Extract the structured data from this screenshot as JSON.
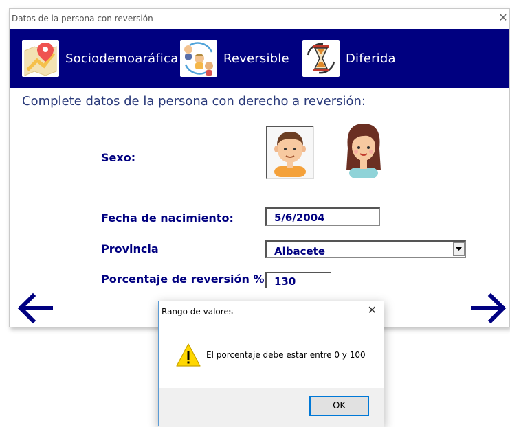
{
  "window": {
    "title": "Datos de la persona con reversión",
    "close_glyph": "✕"
  },
  "tabs": [
    {
      "label": "Sociodemoaráfica",
      "icon": "map-pin-icon"
    },
    {
      "label": "Reversible",
      "icon": "people-exchange-icon"
    },
    {
      "label": "Diferida",
      "icon": "hourglass-icon"
    }
  ],
  "form": {
    "instructions": "Complete datos de la persona con derecho a reversión:",
    "sexo_label": "Sexo:",
    "sexo_options": [
      "male-avatar-icon",
      "female-avatar-icon"
    ],
    "sexo_selected": "male",
    "fecha_label": "Fecha de nacimiento:",
    "fecha_value": "5/6/2004",
    "provincia_label": "Provincia",
    "provincia_value": "Albacete",
    "porcentaje_label": "Porcentaje de reversión %",
    "porcentaje_value": "130"
  },
  "nav": {
    "back_icon": "arrow-left-icon",
    "next_icon": "arrow-right-icon"
  },
  "dialog": {
    "title": "Rango de valores",
    "close_glyph": "✕",
    "message": "El porcentaje debe estar entre 0 y 100",
    "ok_label": "OK",
    "icon": "warning-icon"
  },
  "colors": {
    "banner": "#000080",
    "label": "#000080",
    "dialog_border": "#5b9bd5"
  }
}
